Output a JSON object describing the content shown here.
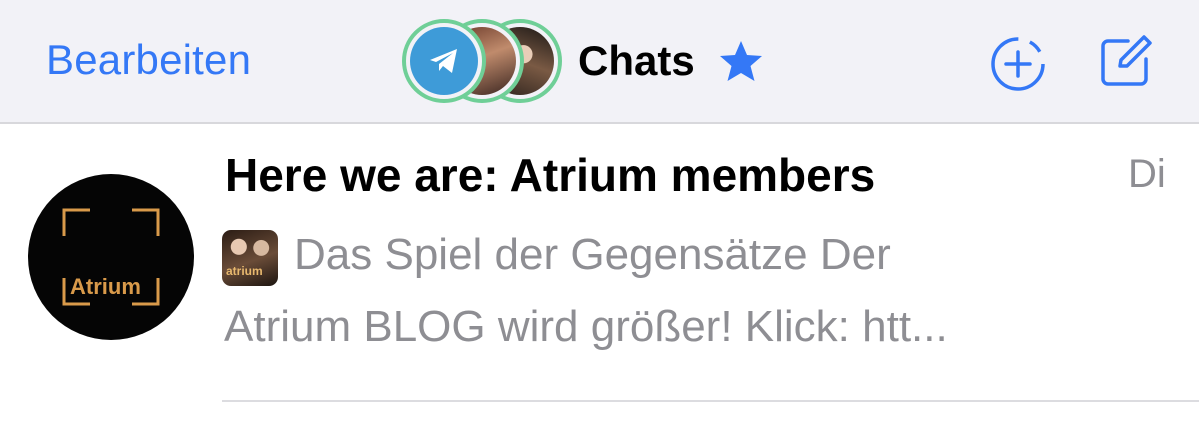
{
  "navbar": {
    "edit_label": "Bearbeiten",
    "title": "Chats",
    "icons": {
      "stories": [
        "telegram-icon",
        "story-avatar",
        "story-avatar"
      ],
      "star": "star-icon",
      "new_story": "add-story-icon",
      "compose": "compose-icon"
    }
  },
  "chats": [
    {
      "title": "Here we are: Atrium members",
      "date": "Di",
      "avatar_text": "Atrium",
      "preview_thumb_text": "atrium",
      "preview_line1": "Das Spiel der Gegensätze Der",
      "preview_line2": "Atrium BLOG wird größer! Klick: htt..."
    }
  ],
  "colors": {
    "accent": "#3478f6",
    "navbar_bg": "#f2f2f7",
    "secondary_text": "#8e8e93",
    "story_ring": "#6fcf97",
    "avatar_gold": "#d99a4a"
  }
}
